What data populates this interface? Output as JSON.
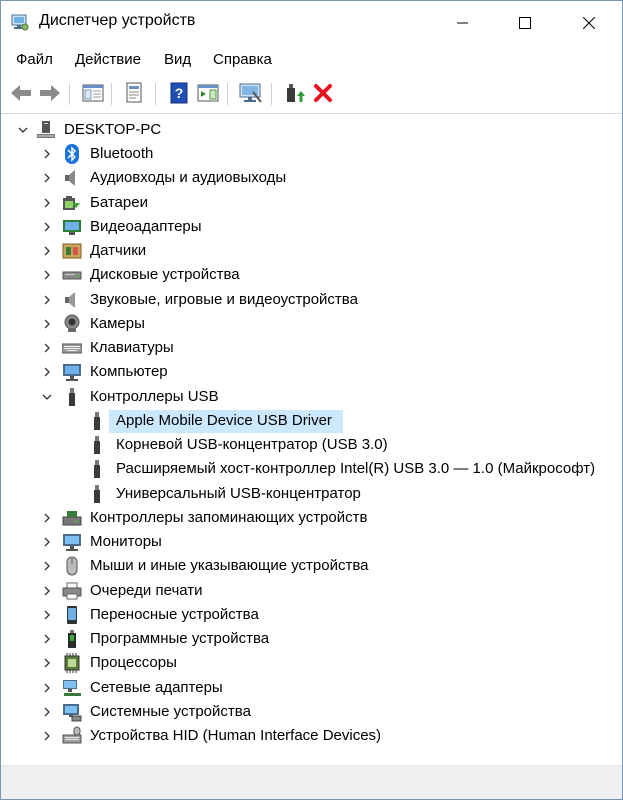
{
  "window": {
    "title": "Диспетчер устройств"
  },
  "menu": {
    "file": "Файл",
    "action": "Действие",
    "view": "Вид",
    "help": "Справка"
  },
  "tree": {
    "root": "DESKTOP-PC",
    "categories": [
      {
        "label": "Bluetooth",
        "icon": "bluetooth-icon"
      },
      {
        "label": "Аудиовходы и аудиовыходы",
        "icon": "speaker-icon"
      },
      {
        "label": "Батареи",
        "icon": "battery-icon"
      },
      {
        "label": "Видеоадаптеры",
        "icon": "display-adapter-icon"
      },
      {
        "label": "Датчики",
        "icon": "sensor-icon"
      },
      {
        "label": "Дисковые устройства",
        "icon": "disk-drive-icon"
      },
      {
        "label": "Звуковые, игровые и видеоустройства",
        "icon": "sound-icon"
      },
      {
        "label": "Камеры",
        "icon": "camera-icon"
      },
      {
        "label": "Клавиатуры",
        "icon": "keyboard-icon"
      },
      {
        "label": "Компьютер",
        "icon": "computer-icon"
      },
      {
        "label": "Контроллеры USB",
        "icon": "usb-icon"
      }
    ],
    "usb_children": [
      "Apple Mobile Device USB Driver",
      "Корневой USB-концентратор (USB 3.0)",
      "Расширяемый хост-контроллер Intel(R) USB 3.0 — 1.0 (Майкрософт)",
      "Универсальный USB-концентратор"
    ],
    "categories_after": [
      {
        "label": "Контроллеры запоминающих устройств",
        "icon": "storage-controller-icon"
      },
      {
        "label": "Мониторы",
        "icon": "monitor-icon"
      },
      {
        "label": "Мыши и иные указывающие устройства",
        "icon": "mouse-icon"
      },
      {
        "label": "Очереди печати",
        "icon": "printer-icon"
      },
      {
        "label": "Переносные устройства",
        "icon": "portable-device-icon"
      },
      {
        "label": "Программные устройства",
        "icon": "software-device-icon"
      },
      {
        "label": "Процессоры",
        "icon": "processor-icon"
      },
      {
        "label": "Сетевые адаптеры",
        "icon": "network-adapter-icon"
      },
      {
        "label": "Системные устройства",
        "icon": "system-device-icon"
      },
      {
        "label": "Устройства HID (Human Interface Devices)",
        "icon": "hid-icon"
      }
    ]
  },
  "colors": {
    "selection": "#cce8ff",
    "accent": "#1a73d9",
    "delete": "#e81123"
  }
}
